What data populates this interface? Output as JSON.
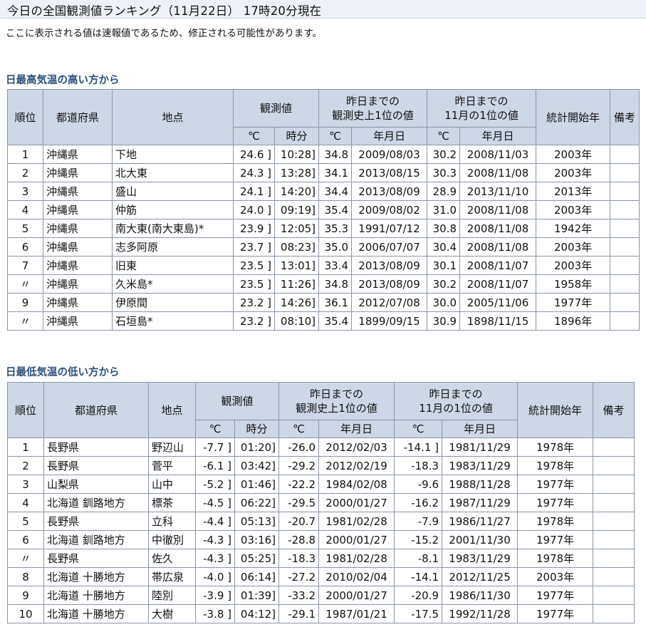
{
  "page": {
    "title": "今日の全国観測値ランキング（11月22日） 17時20分現在",
    "notice": "ここに表示される値は速報値であるため、修正される可能性があります。"
  },
  "headers": {
    "rank": "順位",
    "pref": "都道府県",
    "place": "地点",
    "observed": "観測値",
    "record_all": "昨日までの\n観測史上1位の値",
    "record_month": "昨日までの\n11月の1位の値",
    "start_year": "統計開始年",
    "note": "備考",
    "deg": "℃",
    "time": "時分",
    "ymd": "年月日"
  },
  "high": {
    "title": "日最高気温の高い方から",
    "rows": [
      {
        "rank": "1",
        "pref": "沖縄県",
        "place": "下地",
        "val": "24.6 ]",
        "time": "10:28]",
        "rec_val": "34.8",
        "rec_date": "2009/08/03",
        "mon_val": "30.2",
        "mon_date": "2008/11/03",
        "start": "2003年",
        "note": ""
      },
      {
        "rank": "2",
        "pref": "沖縄県",
        "place": "北大東",
        "val": "24.3 ]",
        "time": "13:28]",
        "rec_val": "34.1",
        "rec_date": "2013/08/15",
        "mon_val": "30.3",
        "mon_date": "2008/11/08",
        "start": "2003年",
        "note": ""
      },
      {
        "rank": "3",
        "pref": "沖縄県",
        "place": "盛山",
        "val": "24.1 ]",
        "time": "14:20]",
        "rec_val": "34.4",
        "rec_date": "2013/08/09",
        "mon_val": "28.9",
        "mon_date": "2013/11/10",
        "start": "2013年",
        "note": ""
      },
      {
        "rank": "4",
        "pref": "沖縄県",
        "place": "仲筋",
        "val": "24.0 ]",
        "time": "09:19]",
        "rec_val": "35.4",
        "rec_date": "2009/08/02",
        "mon_val": "31.0",
        "mon_date": "2008/11/08",
        "start": "2003年",
        "note": ""
      },
      {
        "rank": "5",
        "pref": "沖縄県",
        "place": "南大東(南大東島)*",
        "val": "23.9 ]",
        "time": "12:05]",
        "rec_val": "35.3",
        "rec_date": "1991/07/12",
        "mon_val": "30.8",
        "mon_date": "2008/11/08",
        "start": "1942年",
        "note": ""
      },
      {
        "rank": "6",
        "pref": "沖縄県",
        "place": "志多阿原",
        "val": "23.7 ]",
        "time": "08:23]",
        "rec_val": "35.0",
        "rec_date": "2006/07/07",
        "mon_val": "30.4",
        "mon_date": "2008/11/08",
        "start": "2003年",
        "note": ""
      },
      {
        "rank": "7",
        "pref": "沖縄県",
        "place": "旧東",
        "val": "23.5 ]",
        "time": "13:01]",
        "rec_val": "33.4",
        "rec_date": "2013/08/09",
        "mon_val": "30.1",
        "mon_date": "2008/11/07",
        "start": "2003年",
        "note": ""
      },
      {
        "rank": "〃",
        "pref": "沖縄県",
        "place": "久米島*",
        "val": "23.5 ]",
        "time": "11:26]",
        "rec_val": "34.8",
        "rec_date": "2013/08/09",
        "mon_val": "30.2",
        "mon_date": "2008/11/07",
        "start": "1958年",
        "note": ""
      },
      {
        "rank": "9",
        "pref": "沖縄県",
        "place": "伊原間",
        "val": "23.2 ]",
        "time": "14:26]",
        "rec_val": "36.1",
        "rec_date": "2012/07/08",
        "mon_val": "30.0",
        "mon_date": "2005/11/06",
        "start": "1977年",
        "note": ""
      },
      {
        "rank": "〃",
        "pref": "沖縄県",
        "place": "石垣島*",
        "val": "23.2 ]",
        "time": "08:10]",
        "rec_val": "35.4",
        "rec_date": "1899/09/15",
        "mon_val": "30.9",
        "mon_date": "1898/11/15",
        "start": "1896年",
        "note": ""
      }
    ]
  },
  "low": {
    "title": "日最低気温の低い方から",
    "rows": [
      {
        "rank": "1",
        "pref": "長野県",
        "place": "野辺山",
        "val": "-7.7 ]",
        "time": "01:20]",
        "rec_val": "-26.0",
        "rec_date": "2012/02/03",
        "mon_val": "-14.1 ]",
        "mon_date": "1981/11/29",
        "start": "1978年",
        "note": ""
      },
      {
        "rank": "2",
        "pref": "長野県",
        "place": "菅平",
        "val": "-6.1 ]",
        "time": "03:42]",
        "rec_val": "-29.2",
        "rec_date": "2012/02/19",
        "mon_val": "-18.3",
        "mon_date": "1983/11/29",
        "start": "1978年",
        "note": ""
      },
      {
        "rank": "3",
        "pref": "山梨県",
        "place": "山中",
        "val": "-5.2 ]",
        "time": "01:46]",
        "rec_val": "-22.2",
        "rec_date": "1984/02/08",
        "mon_val": "-9.6",
        "mon_date": "1988/11/28",
        "start": "1977年",
        "note": ""
      },
      {
        "rank": "4",
        "pref": "北海道 釧路地方",
        "place": "標茶",
        "val": "-4.5 ]",
        "time": "06:22]",
        "rec_val": "-29.5",
        "rec_date": "2000/01/27",
        "mon_val": "-16.2",
        "mon_date": "1987/11/29",
        "start": "1977年",
        "note": ""
      },
      {
        "rank": "5",
        "pref": "長野県",
        "place": "立科",
        "val": "-4.4 ]",
        "time": "05:13]",
        "rec_val": "-20.7",
        "rec_date": "1981/02/28",
        "mon_val": "-7.9",
        "mon_date": "1986/11/27",
        "start": "1978年",
        "note": ""
      },
      {
        "rank": "6",
        "pref": "北海道 釧路地方",
        "place": "中徹別",
        "val": "-4.3 ]",
        "time": "03:16]",
        "rec_val": "-28.8",
        "rec_date": "2000/01/27",
        "mon_val": "-15.2",
        "mon_date": "2001/11/30",
        "start": "1977年",
        "note": ""
      },
      {
        "rank": "〃",
        "pref": "長野県",
        "place": "佐久",
        "val": "-4.3 ]",
        "time": "05:25]",
        "rec_val": "-18.3",
        "rec_date": "1981/02/28",
        "mon_val": "-8.1",
        "mon_date": "1983/11/29",
        "start": "1978年",
        "note": ""
      },
      {
        "rank": "8",
        "pref": "北海道 十勝地方",
        "place": "帯広泉",
        "val": "-4.0 ]",
        "time": "06:14]",
        "rec_val": "-27.2",
        "rec_date": "2010/02/04",
        "mon_val": "-14.1",
        "mon_date": "2012/11/25",
        "start": "2003年",
        "note": ""
      },
      {
        "rank": "9",
        "pref": "北海道 十勝地方",
        "place": "陸別",
        "val": "-3.9 ]",
        "time": "01:39]",
        "rec_val": "-33.2",
        "rec_date": "2000/01/27",
        "mon_val": "-20.9",
        "mon_date": "1986/11/30",
        "start": "1977年",
        "note": ""
      },
      {
        "rank": "10",
        "pref": "北海道 十勝地方",
        "place": "大樹",
        "val": "-3.8 ]",
        "time": "04:12]",
        "rec_val": "-29.1",
        "rec_date": "1987/01/21",
        "mon_val": "-17.5",
        "mon_date": "1992/11/28",
        "start": "1977年",
        "note": ""
      }
    ]
  }
}
